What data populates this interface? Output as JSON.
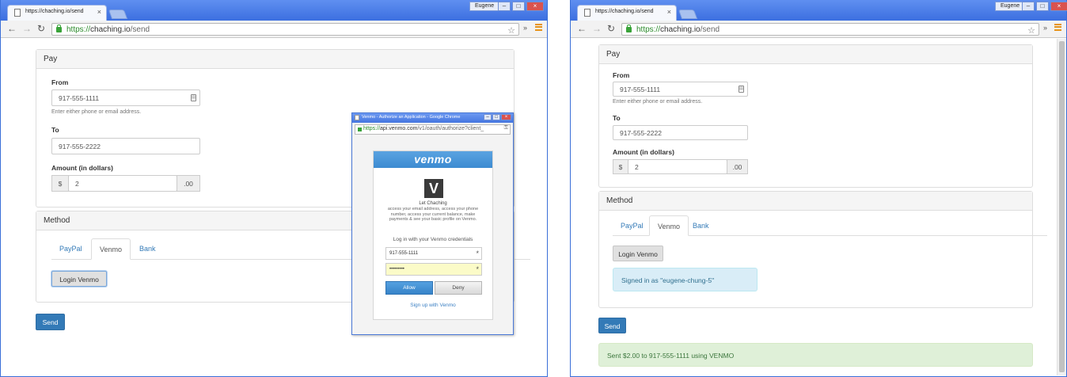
{
  "colors": {
    "titlebar": "#4a7ce6",
    "primary": "#337ab7",
    "link": "#337ab7",
    "info_bg": "#d9edf7",
    "success_bg": "#dff0d8",
    "venmo_blue": "#3d8bd1"
  },
  "left_window": {
    "tab_title": "https://chaching.io/send",
    "user": "Eugene",
    "url_secure": "https://",
    "url_host": "chaching.io",
    "url_path": "/send",
    "pay_heading": "Pay",
    "from_label": "From",
    "from_value": "917-555-1111",
    "help_text": "Enter either phone or email address.",
    "to_label": "To",
    "to_value": "917-555-2222",
    "amount_label": "Amount (in dollars)",
    "currency": "$",
    "amount_value": "2",
    "cents": ".00",
    "method_heading": "Method",
    "tabs": [
      "PayPal",
      "Venmo",
      "Bank"
    ],
    "login_button": "Login Venmo",
    "send_button": "Send"
  },
  "popup": {
    "title": "Venmo - Authorize an Application - Google Chrome",
    "url_secure": "https://",
    "url_host": "api.venmo.com",
    "url_path": "/v1/oauth/authorize?client_",
    "brand": "venmo",
    "logo_letter": "V",
    "app_name": "Let Chaching",
    "permissions": "access your email address, access your phone number, access your current balance, make payments & see your basic profile on Venmo.",
    "login_prompt": "Log in with your Venmo credentials",
    "username": "917-555-1111",
    "password": "•••••••••",
    "allow": "Allow",
    "deny": "Deny",
    "signup": "Sign up with Venmo"
  },
  "right_window": {
    "tab_title": "https://chaching.io/send",
    "user": "Eugene",
    "url_secure": "https://",
    "url_host": "chaching.io",
    "url_path": "/send",
    "pay_heading": "Pay",
    "from_label": "From",
    "from_value": "917-555-1111",
    "help_text": "Enter either phone or email address.",
    "to_label": "To",
    "to_value": "917-555-2222",
    "amount_label": "Amount (in dollars)",
    "currency": "$",
    "amount_value": "2",
    "cents": ".00",
    "method_heading": "Method",
    "tabs": [
      "PayPal",
      "Venmo",
      "Bank"
    ],
    "login_button": "Login Venmo",
    "signed_in": "Signed in as \"eugene-chung-5\"",
    "send_button": "Send",
    "success_message": "Sent $2.00 to 917-555-1111 using VENMO"
  },
  "icons": {
    "page": "page-icon",
    "back": "back-arrow-icon",
    "forward": "forward-arrow-icon",
    "reload": "reload-icon",
    "lock": "lock-icon",
    "star": "star-icon",
    "menu": "menu-icon",
    "contact": "contact-book-icon",
    "key": "key-icon"
  }
}
